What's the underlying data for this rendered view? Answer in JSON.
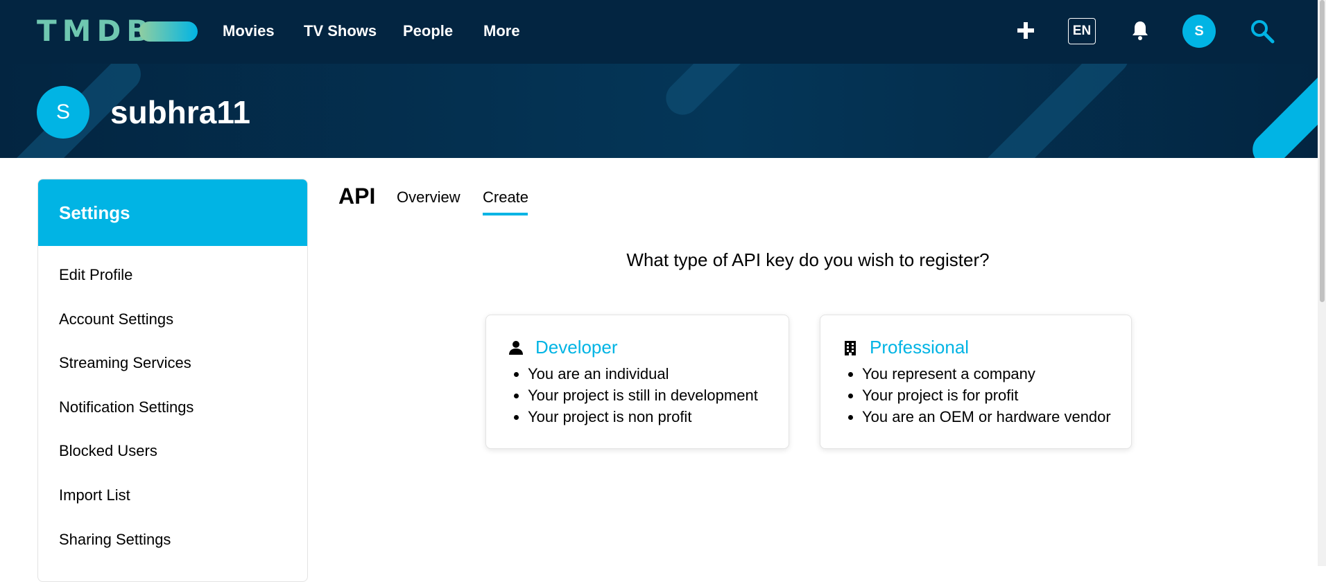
{
  "nav": {
    "logo": "TMDB",
    "links": [
      "Movies",
      "TV Shows",
      "People",
      "More"
    ],
    "language": "EN",
    "avatar_initial": "S"
  },
  "profile": {
    "avatar_initial": "S",
    "username": "subhra11"
  },
  "sidebar": {
    "title": "Settings",
    "items": [
      "Edit Profile",
      "Account Settings",
      "Streaming Services",
      "Notification Settings",
      "Blocked Users",
      "Import List",
      "Sharing Settings"
    ]
  },
  "main": {
    "title": "API",
    "tabs": [
      {
        "label": "Overview",
        "active": false
      },
      {
        "label": "Create",
        "active": true
      }
    ],
    "question": "What type of API key do you wish to register?",
    "cards": [
      {
        "icon": "user-icon",
        "title": "Developer",
        "bullets": [
          "You are an individual",
          "Your project is still in development",
          "Your project is non profit"
        ]
      },
      {
        "icon": "building-icon",
        "title": "Professional",
        "bullets": [
          "You represent a company",
          "Your project is for profit",
          "You are an OEM or hardware vendor"
        ]
      }
    ]
  },
  "colors": {
    "nav_bg": "#032541",
    "accent": "#01b4e4",
    "logo_green": "#6fc7b0"
  }
}
